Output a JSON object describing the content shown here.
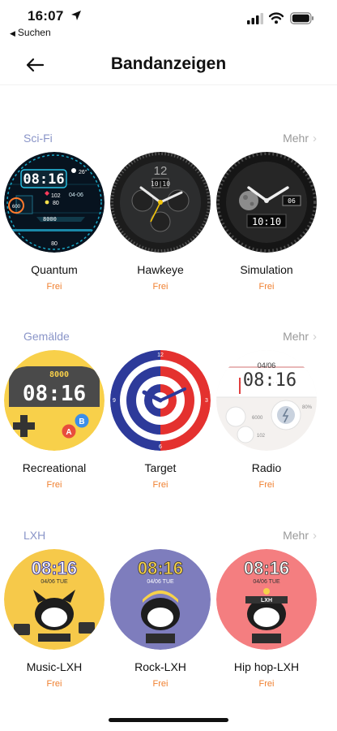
{
  "status": {
    "time": "16:07",
    "back_app": "Suchen"
  },
  "nav": {
    "title": "Bandanzeigen"
  },
  "sections": [
    {
      "title": "Sci-Fi",
      "more": "Mehr",
      "faces": [
        {
          "name": "Quantum",
          "price": "Frei",
          "time": "08:16",
          "temp": "26°",
          "date": "04-06",
          "heart": "102",
          "steps": "8000",
          "misc": "80",
          "cal": "600"
        },
        {
          "name": "Hawkeye",
          "price": "Frei",
          "num12": "12",
          "date": "10|10"
        },
        {
          "name": "Simulation",
          "price": "Frei",
          "digital": "10:10",
          "day": "06"
        }
      ]
    },
    {
      "title": "Gemälde",
      "more": "Mehr",
      "faces": [
        {
          "name": "Recreational",
          "price": "Frei",
          "score": "8000",
          "time": "08:16",
          "btn_a": "A",
          "btn_b": "B"
        },
        {
          "name": "Target",
          "price": "Frei",
          "n12": "12",
          "n3": "3",
          "n6": "6",
          "n9": "9"
        },
        {
          "name": "Radio",
          "price": "Frei",
          "date": "04/06",
          "time": "08:16",
          "steps": "6000",
          "heart": "102",
          "pct": "80%"
        }
      ]
    },
    {
      "title": "LXH",
      "more": "Mehr",
      "faces": [
        {
          "name": "Music-LXH",
          "price": "Frei",
          "time": "08:16",
          "date": "04/06  TUE"
        },
        {
          "name": "Rock-LXH",
          "price": "Frei",
          "time": "08:16",
          "date": "04/06  TUE"
        },
        {
          "name": "Hip hop-LXH",
          "price": "Frei",
          "time": "08:16",
          "date": "04/06  TUE",
          "band": "LXH"
        }
      ]
    }
  ]
}
